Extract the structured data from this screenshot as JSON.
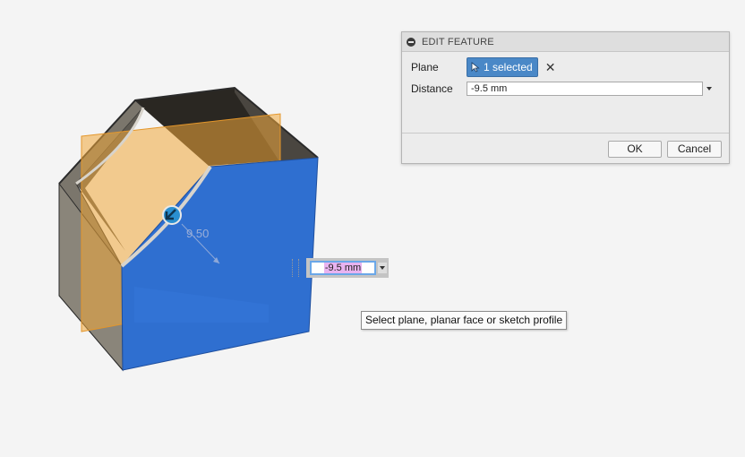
{
  "dialog": {
    "title": "EDIT FEATURE",
    "plane_label": "Plane",
    "plane_selection": "1 selected",
    "distance_label": "Distance",
    "distance_value": "-9.5 mm",
    "ok_label": "OK",
    "cancel_label": "Cancel"
  },
  "canvas": {
    "dimension_label": "9.50",
    "inline_value": "-9.5 mm",
    "tooltip": "Select plane, planar face or sketch profile"
  },
  "colors": {
    "selected_face": "#2f6fd0",
    "offset_plane": "#f0a83a",
    "body_gray": "#7a756b",
    "selection_button": "#4a88c7",
    "inline_highlight": "#e8b3f0"
  }
}
